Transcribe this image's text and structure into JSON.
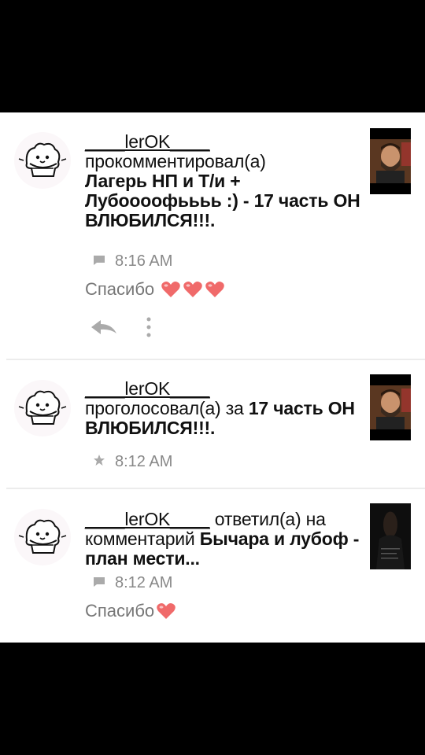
{
  "notifications": [
    {
      "username": "____lerOK____",
      "action": "прокомментировал(а)",
      "title": "Лагерь НП и Т/и + Лубоооофьььь :) - 17 часть ОН ВЛЮБИЛСЯ!!!.",
      "time": "8:16 AM",
      "comment": "Спасибо",
      "time_icon": "comment-icon",
      "hearts": 3
    },
    {
      "username": "____lerOK____",
      "action": "проголосовал(а) за",
      "title": "17 часть ОН ВЛЮБИЛСЯ!!!.",
      "time": "8:12 AM",
      "time_icon": "star-icon"
    },
    {
      "username": "____lerOK____",
      "action": "ответил(а) на комментарий",
      "title": "Бычара и лубоф - план мести...",
      "time": "8:12 AM",
      "comment": "Спасибо",
      "time_icon": "comment-icon",
      "hearts": 1
    }
  ],
  "colors": {
    "heart": "#f06a6a",
    "meta_gray": "#888888",
    "divider": "#ececec"
  }
}
